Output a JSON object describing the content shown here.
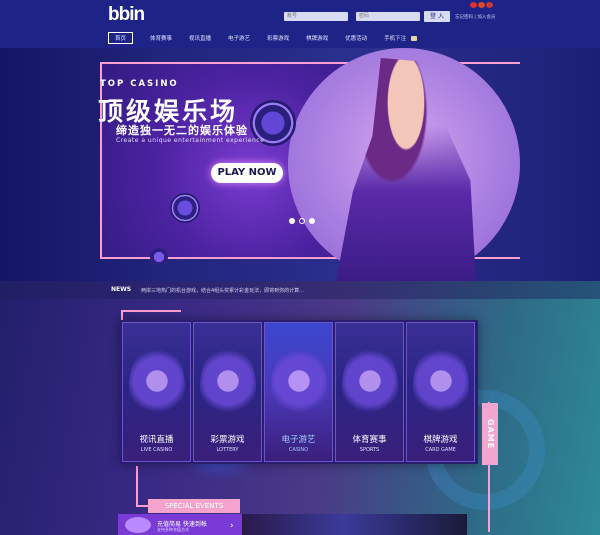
{
  "header": {
    "logo": "bbin",
    "username_placeholder": "账号",
    "password_placeholder": "密码",
    "login_label": "登 入",
    "links": "忘记密码 | 加入会员",
    "flags": [
      "#e03030",
      "#d84a2a",
      "#c83a3a"
    ]
  },
  "nav": {
    "items": [
      {
        "label": "首页"
      },
      {
        "label": "体育赛事"
      },
      {
        "label": "视讯直播"
      },
      {
        "label": "电子游艺"
      },
      {
        "label": "彩票游戏"
      },
      {
        "label": "棋牌游戏"
      },
      {
        "label": "优惠活动"
      },
      {
        "label": "手机下注"
      }
    ]
  },
  "banner": {
    "top_text": "TOP CASINO",
    "title": "顶级娱乐场",
    "subtitle": "缔造独一无二的娱乐体验",
    "subtitle_en": "Create a unique entertainment experience",
    "cta": "PLAY NOW"
  },
  "news": {
    "label": "NEWS",
    "text": "两岸三地热门的机台游戏，结合4组头奖累计彩金玩法，即将到你的计算..."
  },
  "games": {
    "tab_label": "GAME",
    "cards": [
      {
        "zh": "视讯直播",
        "en": "LIVE CASINO"
      },
      {
        "zh": "彩票游戏",
        "en": "LOTTERY"
      },
      {
        "zh": "电子游艺",
        "en": "CASINO"
      },
      {
        "zh": "体育赛事",
        "en": "SPORTS"
      },
      {
        "zh": "棋牌游戏",
        "en": "CARD GAME"
      }
    ]
  },
  "special": {
    "label": "SPECIAL EVENTS",
    "promo_title": "充值简易 快速到帐",
    "promo_sub": "支持多种充值方式"
  },
  "colors": {
    "header_bg": "#1d2387",
    "accent_pink": "#ff9ed0",
    "purple": "#7a3ad6"
  }
}
